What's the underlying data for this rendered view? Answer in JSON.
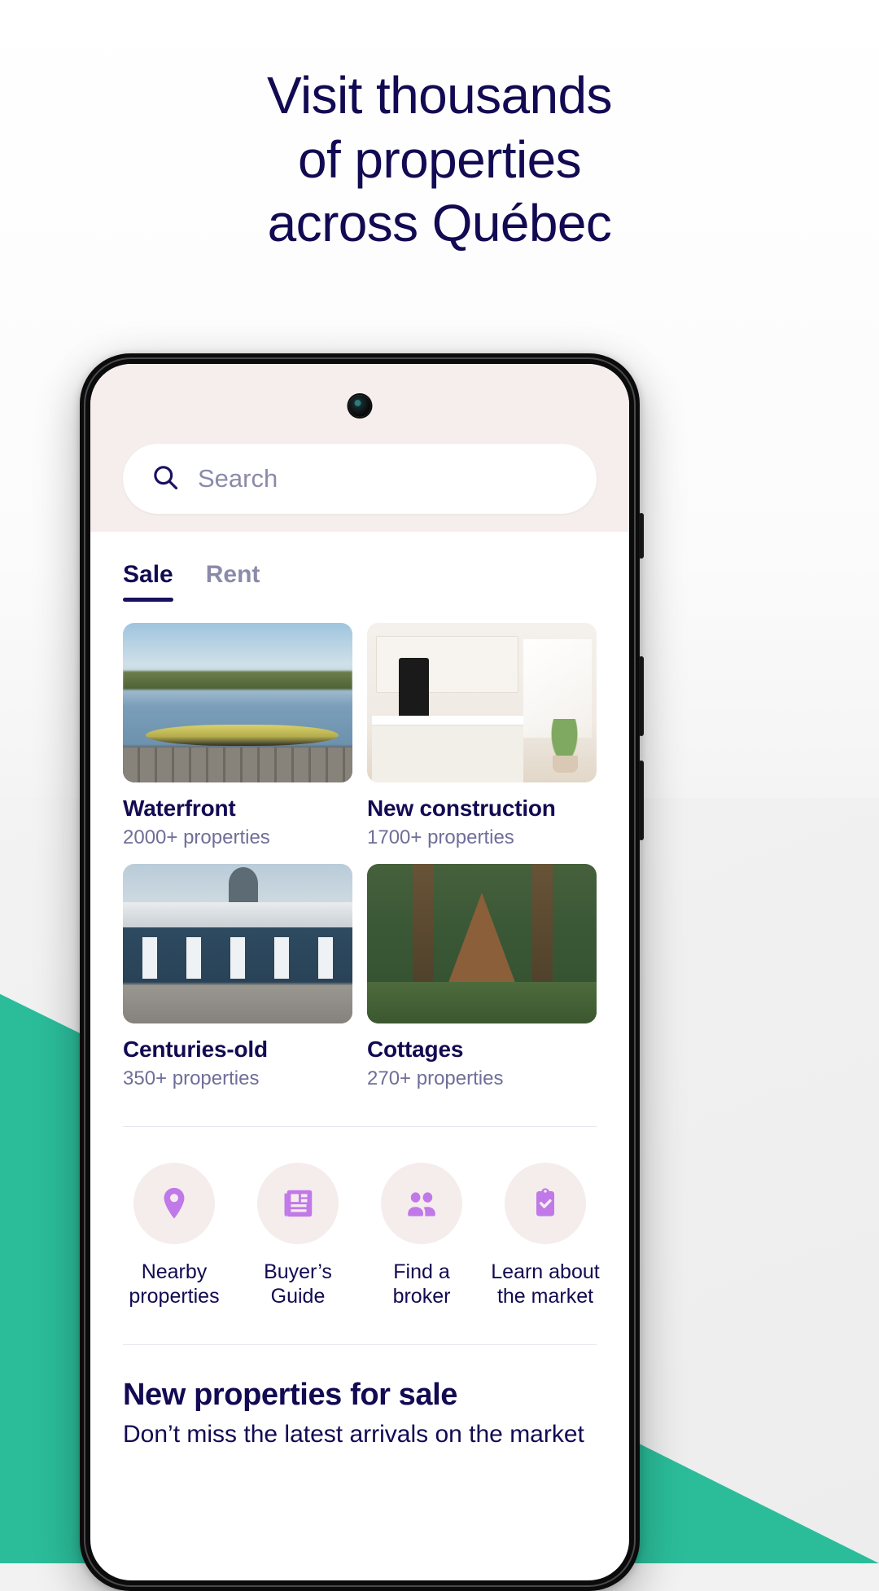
{
  "headline": {
    "line1": "Visit thousands",
    "line2": "of properties",
    "line3": "across Québec",
    "color": "#120a52"
  },
  "colors": {
    "navy": "#120a52",
    "muted_purple": "#6f6e99",
    "accent_purple": "#c178e8",
    "teal": "#2bbd9a",
    "header_bg": "#f5eeec",
    "icon_circle_bg": "#f4edec"
  },
  "app": {
    "search": {
      "placeholder": "Search",
      "icon": "search-icon"
    },
    "tabs": [
      {
        "label": "Sale",
        "active": true
      },
      {
        "label": "Rent",
        "active": false
      }
    ],
    "categories": [
      {
        "title": "Waterfront",
        "count": "2000+ properties",
        "image": "lake-canoe-dock-photo"
      },
      {
        "title": "New construction",
        "count": "1700+ properties",
        "image": "modern-white-kitchen-photo"
      },
      {
        "title": "Centuries-old",
        "count": "350+ properties",
        "image": "historic-quebec-rooftops-photo"
      },
      {
        "title": "Cottages",
        "count": "270+ properties",
        "image": "a-frame-cabin-forest-photo"
      }
    ],
    "quick_actions": [
      {
        "label": "Nearby\nproperties",
        "line1": "Nearby",
        "line2": "properties",
        "icon": "map-pin-icon"
      },
      {
        "label": "Buyer’s\nGuide",
        "line1": "Buyer’s",
        "line2": "Guide",
        "icon": "newspaper-icon"
      },
      {
        "label": "Find a\nbroker",
        "line1": "Find a",
        "line2": "broker",
        "icon": "people-icon"
      },
      {
        "label": "Learn about\nthe market",
        "line1": "Learn about",
        "line2": "the market",
        "icon": "clipboard-check-icon"
      }
    ],
    "bottom_section": {
      "title": "New properties for sale",
      "subtitle": "Don’t miss the latest arrivals on the market"
    }
  }
}
